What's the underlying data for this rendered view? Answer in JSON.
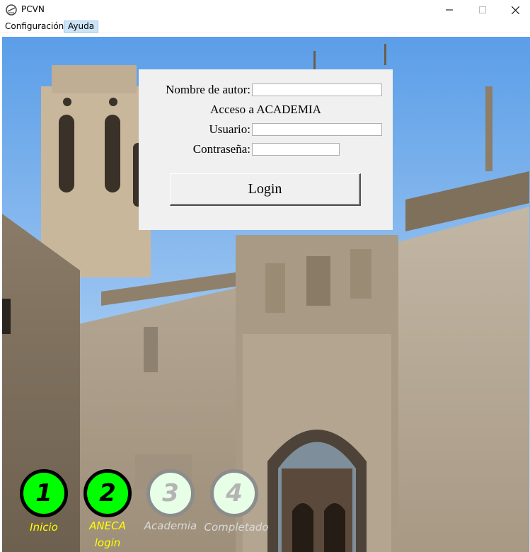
{
  "window": {
    "title": "PCVN"
  },
  "menu": {
    "items": [
      "Configuración",
      "Ayuda"
    ]
  },
  "login_form": {
    "author_label": "Nombre de autor:",
    "author_value": "",
    "section_title": "Acceso a ACADEMIA",
    "user_label": "Usuario:",
    "user_value": "",
    "password_label": "Contraseña:",
    "password_value": "",
    "login_button": "Login"
  },
  "steps": [
    {
      "number": "1",
      "label": "Inicio",
      "state": "done"
    },
    {
      "number": "2",
      "label_line1": "ANECA",
      "label_line2": "login",
      "state": "done"
    },
    {
      "number": "3",
      "label": "Academia",
      "state": "pending"
    },
    {
      "number": "4",
      "label": "Completado",
      "state": "pending"
    }
  ],
  "colors": {
    "step_done": "#00ff00",
    "step_done_label": "#ffff00",
    "step_pending": "#e6ffe6",
    "panel_bg": "#f0f0f0",
    "menu_highlight": "#cce4f7"
  }
}
